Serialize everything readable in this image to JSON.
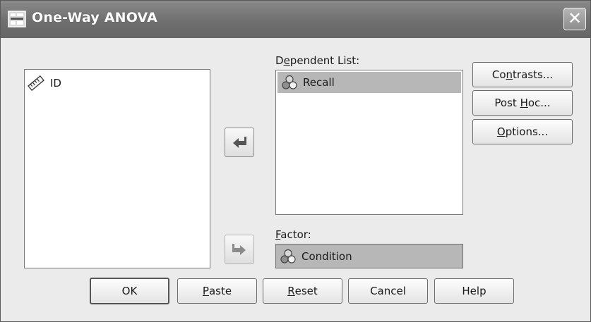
{
  "window": {
    "title": "One-Way ANOVA",
    "title_icon": "spss-dialog-icon",
    "close_icon": "close-icon"
  },
  "variables_list": {
    "items": [
      {
        "label": "ID",
        "icon": "ruler-scale-icon"
      }
    ]
  },
  "dependent_list": {
    "label_prefix": "D",
    "label_mnemonic": "e",
    "label_rest": "pendent List:",
    "items": [
      {
        "label": "Recall",
        "icon": "nominal-variable-icon"
      }
    ]
  },
  "factor": {
    "label_mnemonic": "F",
    "label_rest": "actor:",
    "value": "Condition",
    "icon": "nominal-variable-icon"
  },
  "move_buttons": {
    "to_dependent": "move-left-arrow-icon",
    "to_factor": "move-right-arrow-icon"
  },
  "side_buttons": {
    "contrasts": {
      "pre": "Co",
      "mn": "n",
      "post": "trasts..."
    },
    "post_hoc": {
      "pre": "Post ",
      "mn": "H",
      "post": "oc..."
    },
    "options": {
      "pre": "",
      "mn": "O",
      "post": "ptions..."
    }
  },
  "bottom_buttons": {
    "ok": {
      "pre": "OK",
      "mn": "",
      "post": ""
    },
    "paste": {
      "pre": "",
      "mn": "P",
      "post": "aste"
    },
    "reset": {
      "pre": "",
      "mn": "R",
      "post": "eset"
    },
    "cancel": {
      "pre": "Cancel",
      "mn": "",
      "post": ""
    },
    "help": {
      "pre": "Help",
      "mn": "",
      "post": ""
    }
  },
  "colors": {
    "titlebar": "#767676",
    "dialog_bg": "#ebebeb",
    "selection": "#b7b7b7"
  }
}
